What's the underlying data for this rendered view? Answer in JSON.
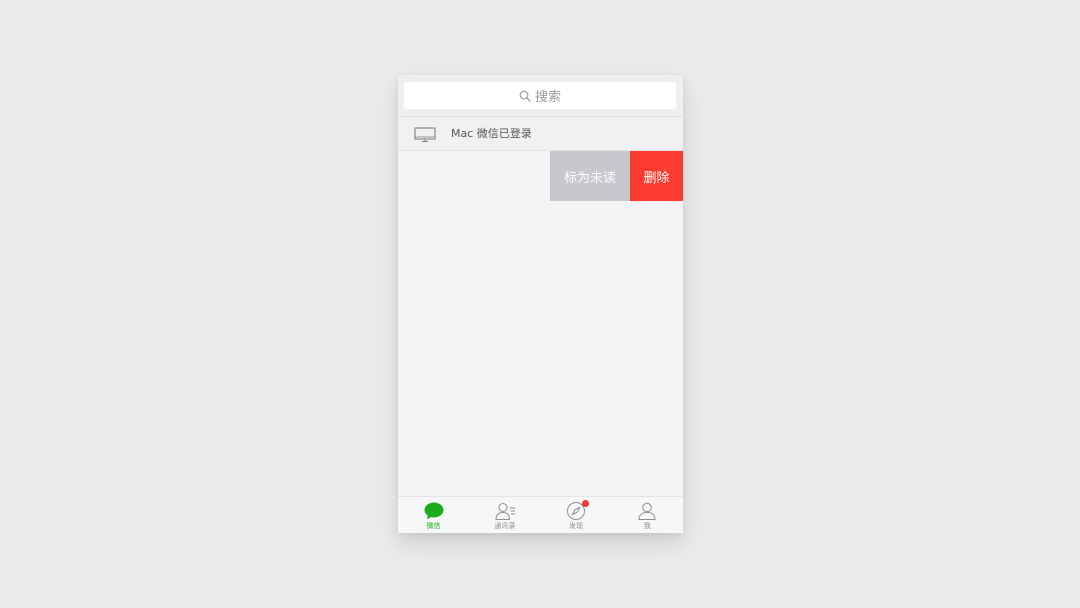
{
  "search": {
    "placeholder": "搜索"
  },
  "mac_login": {
    "text": "Mac 微信已登录",
    "icon": "monitor-icon"
  },
  "swipe_actions": {
    "mark_unread_label": "标为未读",
    "delete_label": "删除"
  },
  "tabbar": {
    "items": [
      {
        "label": "微信",
        "icon": "chat-bubble-icon",
        "active": true
      },
      {
        "label": "通讯录",
        "icon": "contacts-icon",
        "active": false
      },
      {
        "label": "发现",
        "icon": "compass-icon",
        "active": false,
        "badge": true
      },
      {
        "label": "我",
        "icon": "person-icon",
        "active": false
      }
    ]
  },
  "colors": {
    "accent_green": "#1aad19",
    "delete_red": "#fb3b2f",
    "mark_gray": "#c7c7cc",
    "badge_red": "#f43530"
  }
}
